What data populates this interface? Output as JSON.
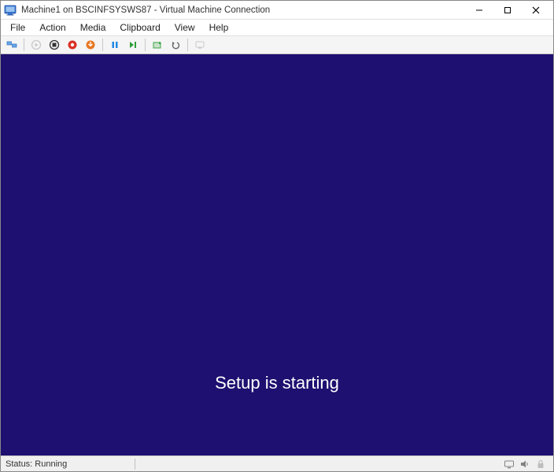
{
  "window": {
    "title": "Machine1 on BSCINFSYSWS87 - Virtual Machine Connection"
  },
  "menu": {
    "file": "File",
    "action": "Action",
    "media": "Media",
    "clipboard": "Clipboard",
    "view": "View",
    "help": "Help"
  },
  "toolbar": {
    "ctrl_alt_del": "Ctrl+Alt+Del",
    "start": "Start",
    "turn_off": "Turn Off",
    "shutdown": "Shut Down",
    "save": "Save",
    "pause": "Pause",
    "reset": "Reset",
    "checkpoint": "Checkpoint",
    "revert": "Revert",
    "enhanced": "Enhanced Session"
  },
  "viewport": {
    "setup_message": "Setup is starting"
  },
  "status": {
    "text": "Status: Running"
  }
}
